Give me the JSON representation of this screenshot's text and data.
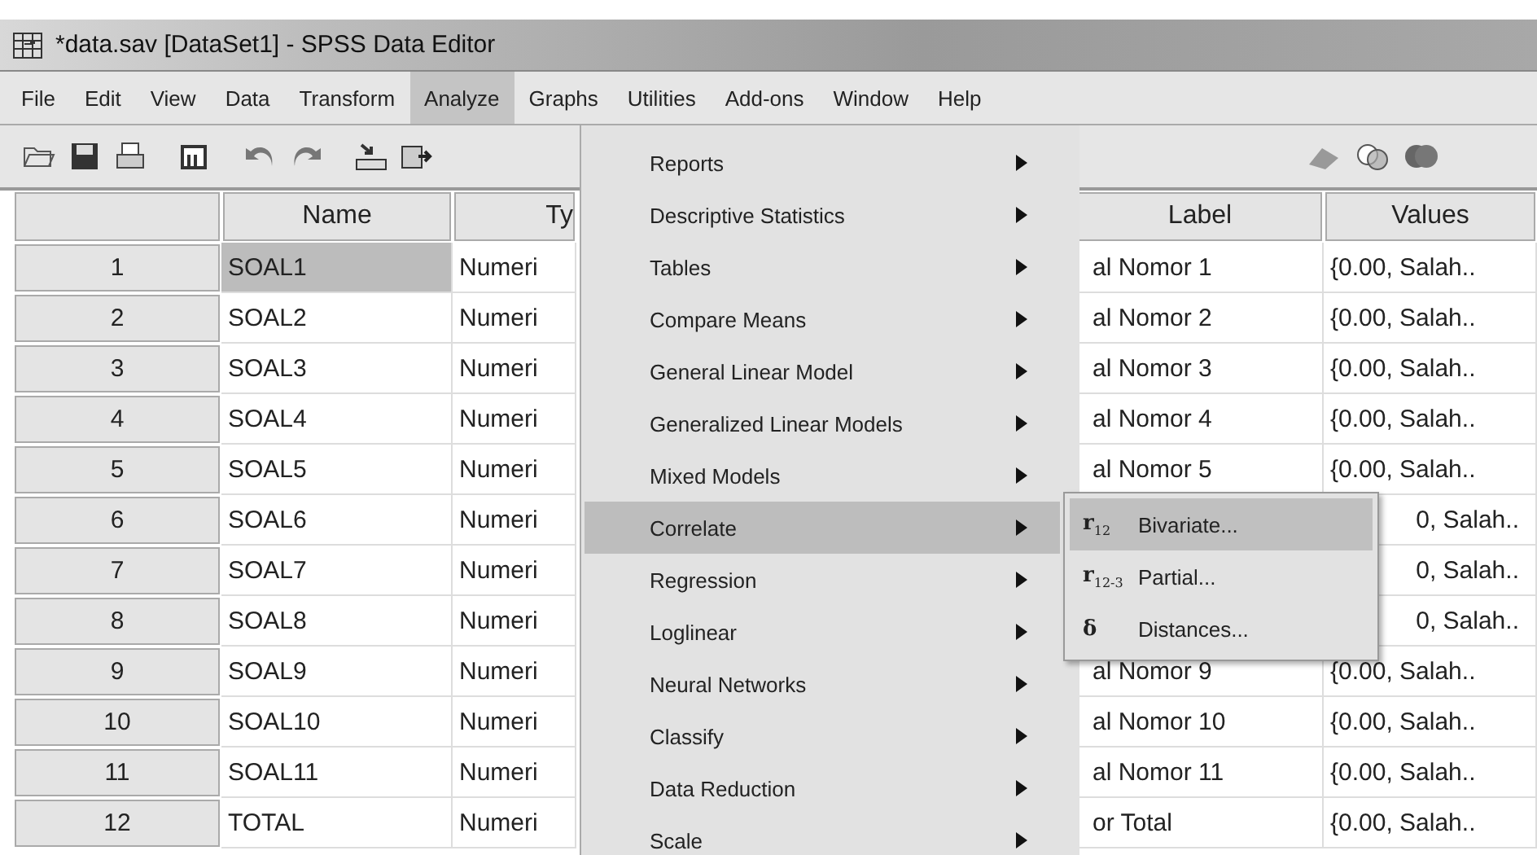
{
  "window": {
    "title": "*data.sav [DataSet1] - SPSS Data Editor"
  },
  "menu_bar": [
    {
      "label": "File",
      "selected": false
    },
    {
      "label": "Edit",
      "selected": false
    },
    {
      "label": "View",
      "selected": false
    },
    {
      "label": "Data",
      "selected": false
    },
    {
      "label": "Transform",
      "selected": false
    },
    {
      "label": "Analyze",
      "selected": true
    },
    {
      "label": "Graphs",
      "selected": false
    },
    {
      "label": "Utilities",
      "selected": false
    },
    {
      "label": "Add-ons",
      "selected": false
    },
    {
      "label": "Window",
      "selected": false
    },
    {
      "label": "Help",
      "selected": false
    }
  ],
  "table": {
    "columns": [
      "Name",
      "Ty",
      "Label",
      "Values"
    ],
    "rows": [
      {
        "number": "1",
        "name": "SOAL1",
        "type": "Numeri",
        "label": "al Nomor 1",
        "values": "{0.00, Salah..",
        "selected": true
      },
      {
        "number": "2",
        "name": "SOAL2",
        "type": "Numeri",
        "label": "al Nomor 2",
        "values": "{0.00, Salah..",
        "selected": false
      },
      {
        "number": "3",
        "name": "SOAL3",
        "type": "Numeri",
        "label": "al Nomor 3",
        "values": "{0.00, Salah..",
        "selected": false
      },
      {
        "number": "4",
        "name": "SOAL4",
        "type": "Numeri",
        "label": "al Nomor 4",
        "values": "{0.00, Salah..",
        "selected": false
      },
      {
        "number": "5",
        "name": "SOAL5",
        "type": "Numeri",
        "label": "al Nomor 5",
        "values": "{0.00, Salah..",
        "selected": false
      },
      {
        "number": "6",
        "name": "SOAL6",
        "type": "Numeri",
        "values": "0, Salah..",
        "selected": false
      },
      {
        "number": "7",
        "name": "SOAL7",
        "type": "Numeri",
        "values": "0, Salah..",
        "selected": false
      },
      {
        "number": "8",
        "name": "SOAL8",
        "type": "Numeri",
        "values": "0, Salah..",
        "selected": false
      },
      {
        "number": "9",
        "name": "SOAL9",
        "type": "Numeri",
        "label": "al Nomor 9",
        "values": "{0.00, Salah..",
        "selected": false
      },
      {
        "number": "10",
        "name": "SOAL10",
        "type": "Numeri",
        "label": "al Nomor 10",
        "values": "{0.00, Salah..",
        "selected": false
      },
      {
        "number": "11",
        "name": "SOAL11",
        "type": "Numeri",
        "label": "al Nomor 11",
        "values": "{0.00, Salah..",
        "selected": false
      },
      {
        "number": "12",
        "name": "TOTAL",
        "type": "Numeri",
        "label": "or Total",
        "values": "{0.00, Salah..",
        "selected": false
      }
    ]
  },
  "analyze_menu": [
    {
      "label": "Reports",
      "selected": false
    },
    {
      "label": "Descriptive Statistics",
      "selected": false
    },
    {
      "label": "Tables",
      "selected": false
    },
    {
      "label": "Compare Means",
      "selected": false
    },
    {
      "label": "General Linear Model",
      "selected": false
    },
    {
      "label": "Generalized Linear Models",
      "selected": false
    },
    {
      "label": "Mixed Models",
      "selected": false
    },
    {
      "label": "Correlate",
      "selected": true
    },
    {
      "label": "Regression",
      "selected": false
    },
    {
      "label": "Loglinear",
      "selected": false
    },
    {
      "label": "Neural Networks",
      "selected": false
    },
    {
      "label": "Classify",
      "selected": false
    },
    {
      "label": "Data Reduction",
      "selected": false
    },
    {
      "label": "Scale",
      "selected": false
    }
  ],
  "correlate_submenu": [
    {
      "label": "Bivariate...",
      "icon": "r",
      "icon_sub": "12",
      "selected": true
    },
    {
      "label": "Partial...",
      "icon": "r",
      "icon_sub": "12-3",
      "selected": false
    },
    {
      "label": "Distances...",
      "icon": "δ",
      "selected": false
    }
  ]
}
